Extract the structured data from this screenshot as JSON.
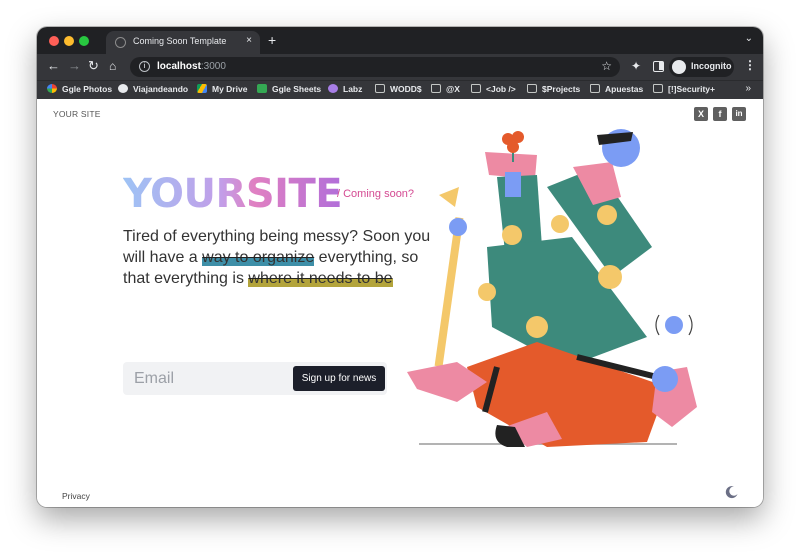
{
  "browser": {
    "tab_title": "Coming Soon Template",
    "tab_close": "×",
    "new_tab": "+",
    "tabs_menu": "⌄",
    "url_host": "localhost",
    "url_port": ":3000",
    "incognito_label": "Incognito",
    "bookmarks": [
      {
        "label": "Ggle Photos",
        "icon": "photos-icon"
      },
      {
        "label": "Viajandeando",
        "icon": "wordpress-icon"
      },
      {
        "label": "My Drive",
        "icon": "drive-icon"
      },
      {
        "label": "Ggle Sheets",
        "icon": "sheets-icon"
      },
      {
        "label": "Labz",
        "icon": "labz-icon"
      },
      {
        "label": "WODD$",
        "icon": "folder-icon"
      },
      {
        "label": "@X",
        "icon": "folder-icon"
      },
      {
        "label": "<Job />",
        "icon": "folder-icon"
      },
      {
        "label": "$Projects",
        "icon": "folder-icon"
      },
      {
        "label": "Apuestas",
        "icon": "folder-icon"
      },
      {
        "label": "[!]Security+",
        "icon": "folder-icon"
      }
    ],
    "bookmarks_more": "»"
  },
  "page": {
    "site_label": "YOUR SITE",
    "social": [
      {
        "name": "x-icon",
        "glyph": "X"
      },
      {
        "name": "facebook-icon",
        "glyph": "f"
      },
      {
        "name": "linkedin-icon",
        "glyph": "in"
      }
    ],
    "hero_title": "YOURSITE",
    "coming_soon": "/ Coming soon?",
    "tagline_1": "Tired of everything being messy? Soon you will have a ",
    "tagline_hl_1": "way to organize",
    "tagline_2": " everything, so that everything is ",
    "tagline_hl_2": "where it needs to be",
    "email_placeholder": "Email",
    "signup_label": "Sign up for news",
    "privacy_label": "Privacy"
  },
  "colors": {
    "title_gradient": [
      "#9ec3f5",
      "#c29ee8",
      "#e080c2",
      "#b16ed9"
    ],
    "accent_pink": "#d44a92",
    "highlight_blue": "#3e8fa8",
    "highlight_yellow": "#b3a43b",
    "button_dark": "#1c1f2a"
  }
}
